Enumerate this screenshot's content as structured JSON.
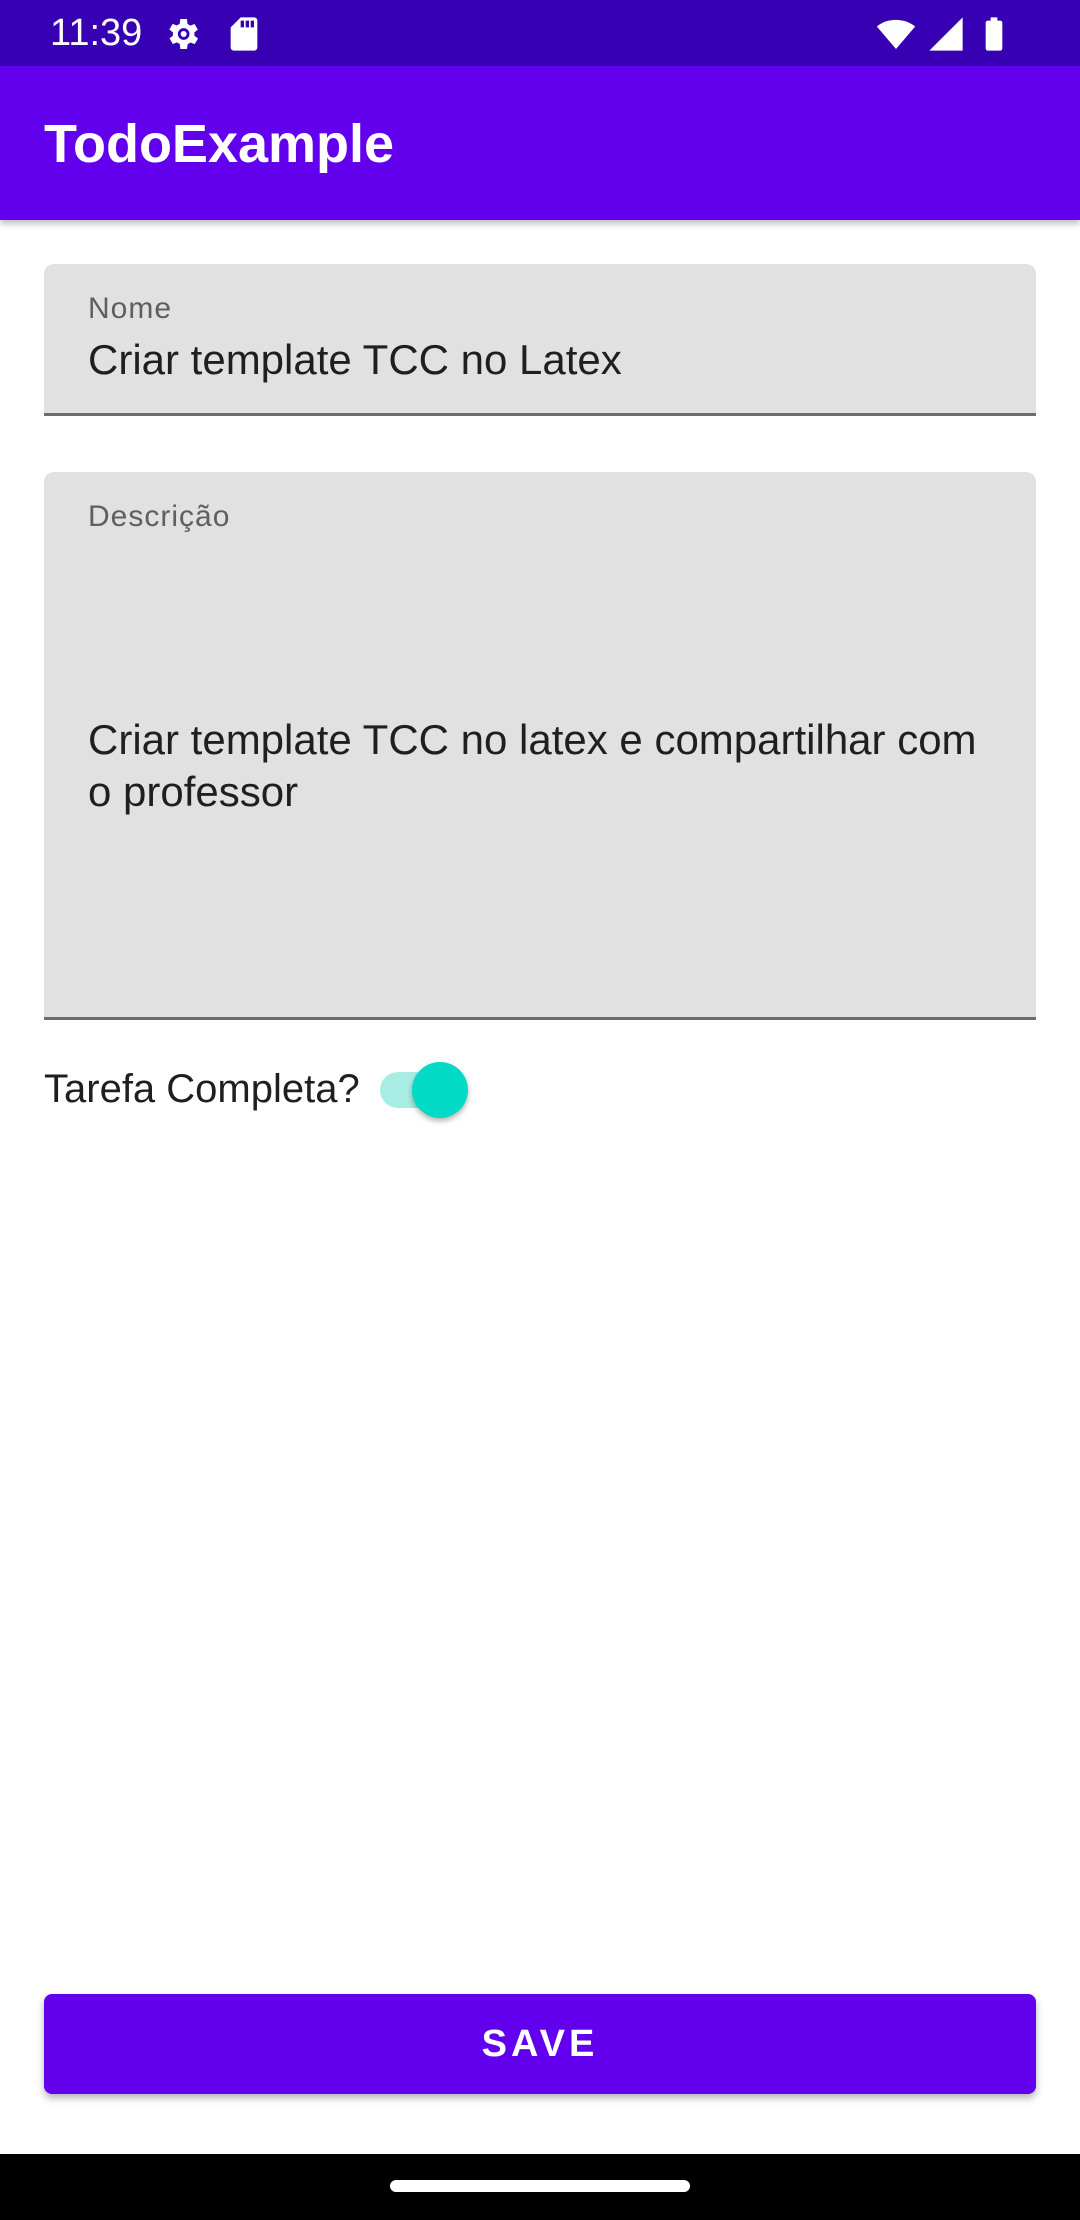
{
  "status_bar": {
    "time": "11:39",
    "icons": [
      "settings-gear-icon",
      "sd-card-icon",
      "wifi-icon",
      "cellular-signal-icon",
      "battery-icon"
    ],
    "background": "#3700b3"
  },
  "app_bar": {
    "title": "TodoExample",
    "background": "#6200ee"
  },
  "form": {
    "name_field": {
      "label": "Nome",
      "value": "Criar template TCC no Latex"
    },
    "description_field": {
      "label": "Descrição",
      "value": "Criar template TCC no latex e compartilhar com o professor"
    },
    "complete_switch": {
      "label": "Tarefa Completa?",
      "checked": true,
      "accent": "#03dac5"
    }
  },
  "actions": {
    "save_label": "SAVE"
  }
}
